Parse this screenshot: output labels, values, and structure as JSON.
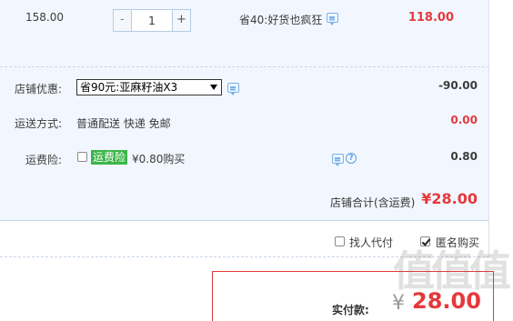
{
  "item": {
    "unit_price": "158.00",
    "quantity": "1",
    "minus_label": "-",
    "plus_label": "+",
    "promo": "省40:好货也疯狂",
    "subtotal": "118.00"
  },
  "shop": {
    "discount_label": "店铺优惠:",
    "discount_selected": "省90元:亚麻籽油X3",
    "discount_value": "-90.00",
    "shipping_label": "运送方式:",
    "shipping_text": "普通配送 快递 免邮",
    "shipping_value": "0.00",
    "insurance_label": "运费险:",
    "insurance_badge": "运费险",
    "insurance_price": "¥0.80购买",
    "insurance_value": "0.80",
    "total_label": "店铺合计(含运费)",
    "total_value": "¥28.00"
  },
  "options": {
    "proxy_pay": "找人代付",
    "anonymous": "匿名购买"
  },
  "payment": {
    "label": "实付款:",
    "yen": "¥",
    "amount": "28.00"
  },
  "watermark": "值值值",
  "colors": {
    "accent_red": "#e4393c",
    "panel_bg": "#f2f7ff",
    "badge_green": "#3bb54a"
  }
}
